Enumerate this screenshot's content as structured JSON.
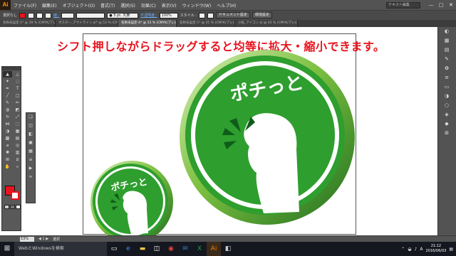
{
  "app": {
    "logo": "Ai",
    "search_placeholder": "テキスト編集"
  },
  "menu": [
    "ファイル(F)",
    "編集(E)",
    "オブジェクト(O)",
    "書式(T)",
    "選択(S)",
    "効果(C)",
    "表示(V)",
    "ウィンドウ(W)",
    "ヘルプ(H)"
  ],
  "window_controls": {
    "minimize": "—",
    "restore": "□",
    "close": "✕"
  },
  "control": {
    "selection_label": "選択なし",
    "stroke_label": "線 :",
    "brush_value": "● 5 pt. 丸筆",
    "opacity_label": "不透明度 :",
    "opacity_value": "100%",
    "style_label": "スタイル :",
    "doc_settings": "ドキュメント設定",
    "preferences": "環境設定",
    "fill_color": "#e8141e"
  },
  "tabs": [
    "名称未設定-1* @ 39 % (CMYK/プレビュー)",
    "ポスター_アウトライン.ai* @ 53 % (CMYK/プレビュー)",
    "名称未設定-4* @ 53 % (CMYK/プレビュー)",
    "名称未設定-5* @ 41 % (CMYK/プレビュー)",
    "小枝_アイコン.ai @ 43 % (CMYK/プレビュー)"
  ],
  "canvas": {
    "headline": "シフト押しながらドラッグすると均等に拡大・縮小できます。",
    "logo_text": "ポチっと",
    "accent": "#e8141e",
    "green": "#2e9e2e"
  },
  "status": {
    "zoom": "53%",
    "mode": "選択"
  },
  "taskbar": {
    "search_placeholder": "WebとWindowsを検索",
    "time": "21:12",
    "date": "2016/06/03"
  }
}
